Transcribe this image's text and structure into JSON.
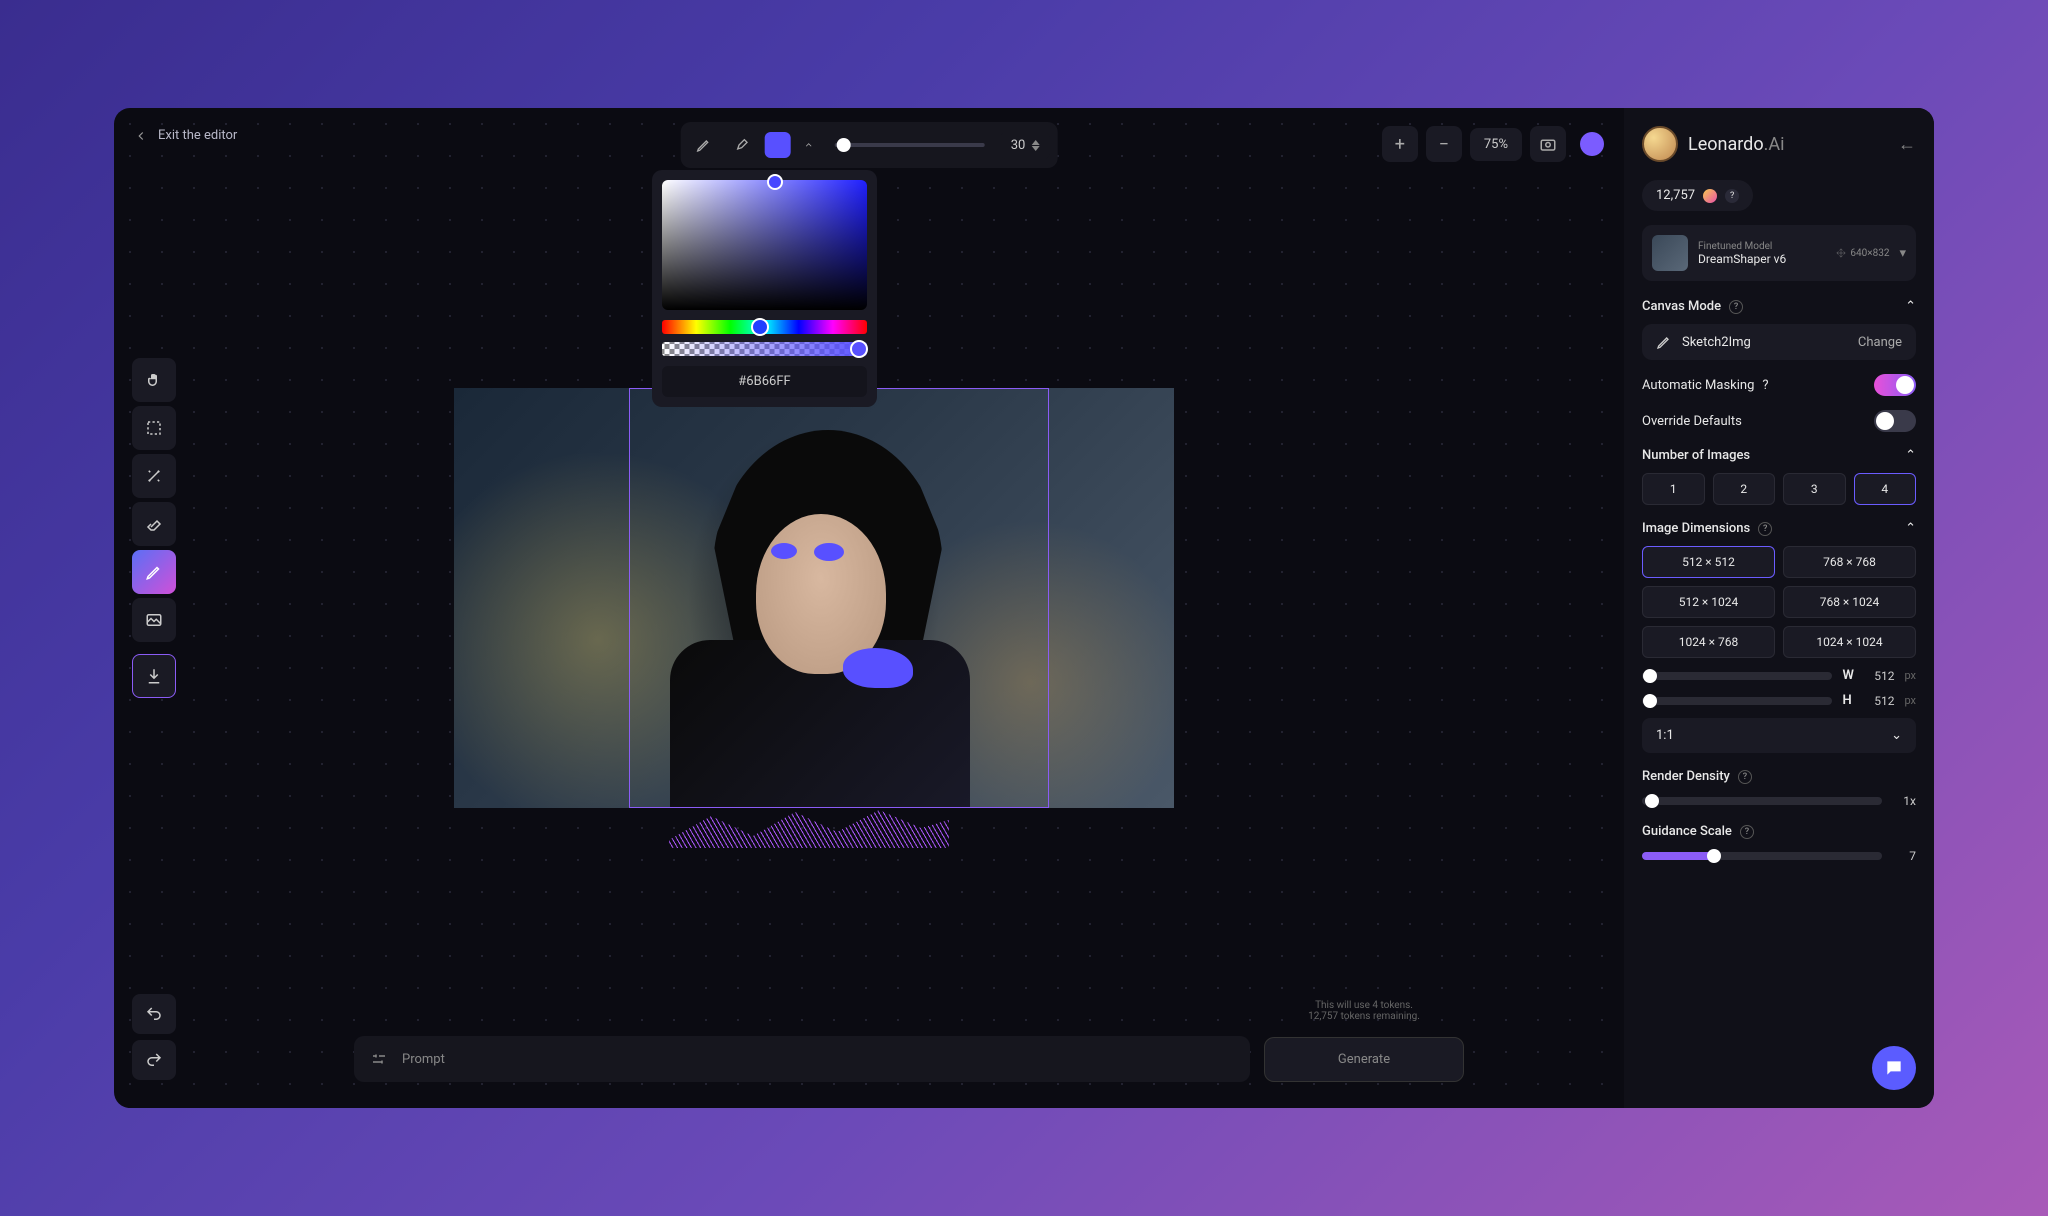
{
  "header": {
    "exit_label": "Exit the editor",
    "brush_size": "30",
    "zoom": "75%",
    "color_hex": "#6B66FF"
  },
  "brand": {
    "name": "Leonardo",
    "suffix": ".Ai"
  },
  "credits": "12,757",
  "model": {
    "label": "Finetuned Model",
    "name": "DreamShaper v6",
    "dims": "640×832"
  },
  "canvas_mode": {
    "title": "Canvas Mode",
    "value": "Sketch2Img",
    "change": "Change"
  },
  "toggles": {
    "auto_mask": "Automatic Masking",
    "override": "Override Defaults"
  },
  "num_images": {
    "title": "Number of Images",
    "options": [
      "1",
      "2",
      "3",
      "4"
    ]
  },
  "dimensions": {
    "title": "Image Dimensions",
    "options": [
      "512 × 512",
      "768 × 768",
      "512 × 1024",
      "768 × 1024",
      "1024 × 768",
      "1024 × 1024"
    ],
    "w_label": "W",
    "h_label": "H",
    "w_value": "512",
    "h_value": "512",
    "px": "px",
    "ratio": "1:1"
  },
  "render_density": {
    "title": "Render Density",
    "value": "1x"
  },
  "guidance": {
    "title": "Guidance Scale",
    "value": "7"
  },
  "prompt": {
    "placeholder": "Prompt",
    "generate": "Generate",
    "token_line1": "This will use 4 tokens.",
    "token_line2": "12,757 tokens remaining."
  }
}
